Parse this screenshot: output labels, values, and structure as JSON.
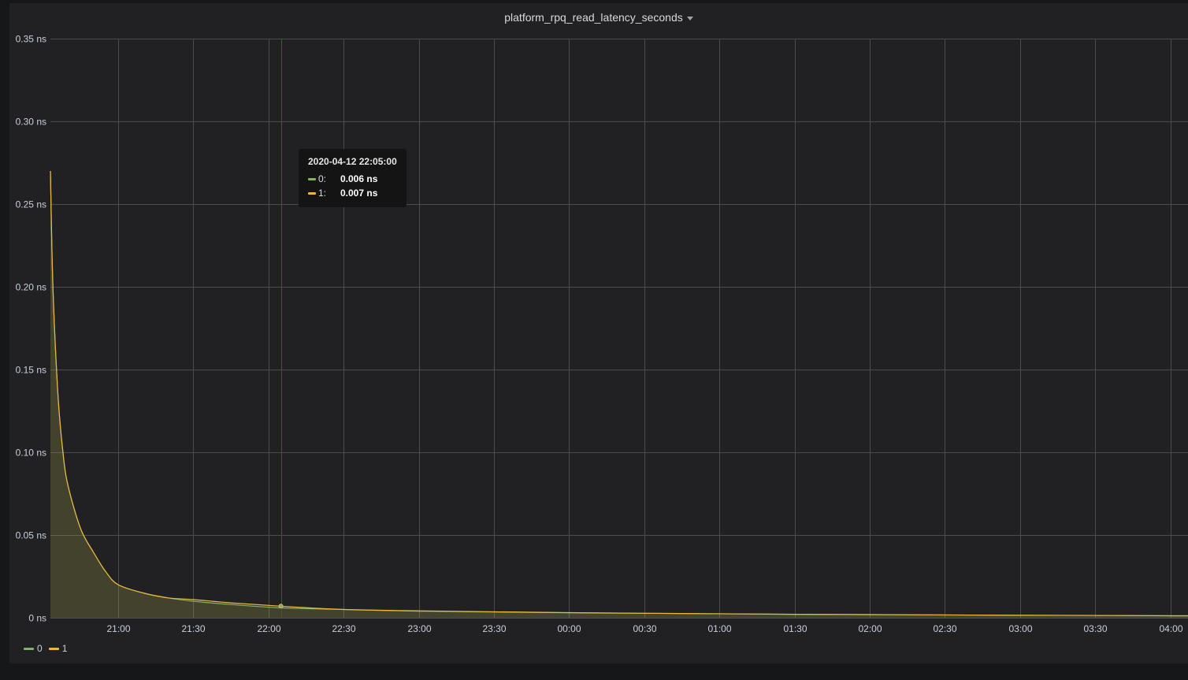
{
  "panel": {
    "title": "platform_rpq_read_latency_seconds"
  },
  "tooltip": {
    "time": "2020-04-12 22:05:00",
    "rows": [
      {
        "name": "0:",
        "value": "0.006 ns",
        "color": "#7eb26d"
      },
      {
        "name": "1:",
        "value": "0.007 ns",
        "color": "#eab839"
      }
    ]
  },
  "legend": [
    {
      "name": "0",
      "color": "#7eb26d"
    },
    {
      "name": "1",
      "color": "#eab839"
    }
  ],
  "colors": {
    "crosshair": "#c4162a",
    "fill": "#eab839"
  },
  "chart_data": {
    "type": "area",
    "title": "platform_rpq_read_latency_seconds",
    "xlabel": "",
    "ylabel": "",
    "ylim": [
      0,
      0.35
    ],
    "y_unit": "ns",
    "y_ticks": [
      "0 ns",
      "0.05 ns",
      "0.10 ns",
      "0.15 ns",
      "0.20 ns",
      "0.25 ns",
      "0.30 ns",
      "0.35 ns"
    ],
    "x_range": [
      "20:33",
      "04:07"
    ],
    "x_ticks": [
      "21:00",
      "21:30",
      "22:00",
      "22:30",
      "23:00",
      "23:30",
      "00:00",
      "00:30",
      "01:00",
      "01:30",
      "02:00",
      "02:30",
      "03:00",
      "03:30",
      "04:00"
    ],
    "crosshair_x": "22:05",
    "grid": true,
    "legend_position": "bottom-left",
    "x": [
      "20:33",
      "20:34",
      "20:36",
      "20:38",
      "20:40",
      "20:45",
      "20:50",
      "20:55",
      "21:00",
      "21:10",
      "21:20",
      "21:30",
      "21:45",
      "22:05",
      "22:30",
      "23:00",
      "23:30",
      "00:00",
      "00:30",
      "01:00",
      "01:30",
      "02:00",
      "02:30",
      "03:00",
      "03:30",
      "04:00",
      "04:07"
    ],
    "series": [
      {
        "name": "0",
        "color": "#7eb26d",
        "values": [
          0.27,
          0.2,
          0.135,
          0.1,
          0.08,
          0.054,
          0.04,
          0.028,
          0.02,
          0.015,
          0.012,
          0.01,
          0.008,
          0.006,
          0.005,
          0.004,
          0.0035,
          0.003,
          0.0027,
          0.0024,
          0.0021,
          0.0019,
          0.0017,
          0.0015,
          0.0014,
          0.0012,
          0.0012
        ]
      },
      {
        "name": "1",
        "color": "#eab839",
        "values": [
          0.27,
          0.2,
          0.135,
          0.1,
          0.08,
          0.054,
          0.04,
          0.028,
          0.02,
          0.015,
          0.012,
          0.011,
          0.009,
          0.007,
          0.005,
          0.0042,
          0.0036,
          0.0031,
          0.0027,
          0.0024,
          0.0021,
          0.0019,
          0.0017,
          0.0015,
          0.0014,
          0.0012,
          0.0012
        ]
      }
    ]
  }
}
